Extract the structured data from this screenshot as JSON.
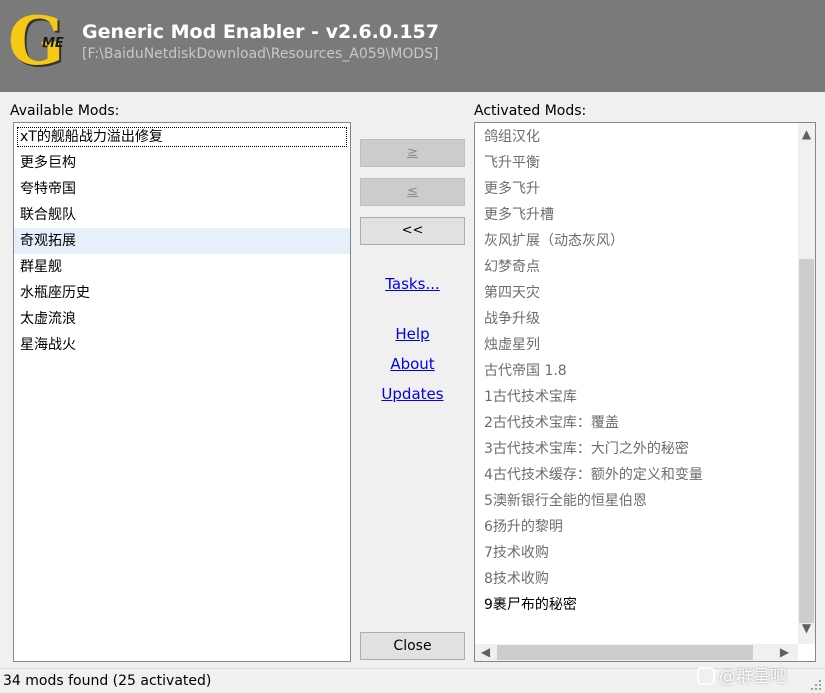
{
  "header": {
    "logo_letter": "G",
    "logo_sub": "ME",
    "title": "Generic Mod Enabler - v2.6.0.157",
    "path": "[F:\\BaiduNetdiskDownload\\Resources_A059\\MODS]"
  },
  "available": {
    "label": "Available Mods:",
    "items": [
      "xT的舰船战力溢出修复",
      "更多巨构",
      "夸特帝国",
      "联合舰队",
      "奇观拓展",
      "群星舰",
      "水瓶座历史",
      "太虚流浪",
      "星海战火"
    ]
  },
  "activated": {
    "label": "Activated Mods:",
    "items": [
      "鸽组汉化",
      "飞升平衡",
      "更多飞升",
      "更多飞升槽",
      "灰风扩展（动态灰风）",
      "幻梦奇点",
      "第四天灾",
      "战争升级",
      "烛虚星列",
      "古代帝国 1.8",
      "1古代技术宝库",
      "2古代技术宝库：覆盖",
      "3古代技术宝库：大门之外的秘密",
      "4古代技术缓存：额外的定义和变量",
      "5澳新银行全能的恒星伯恩",
      "6扬升的黎明",
      "7技术收购",
      "8技术收购",
      "9裹尸布的秘密"
    ]
  },
  "buttons": {
    "activate": "≥",
    "deactivate": "≤",
    "deactivate_all": "<<",
    "close": "Close"
  },
  "links": {
    "tasks": "Tasks...",
    "help": "Help",
    "about": "About",
    "updates": "Updates"
  },
  "status": {
    "text": "34 mods found (25 activated)"
  },
  "watermark": {
    "text": "@群星吧"
  },
  "colors": {
    "header_bg": "#7a7a7a",
    "logo_yellow": "#f6c915",
    "link_blue": "#0000ee",
    "selection": "#e5f0fb"
  }
}
